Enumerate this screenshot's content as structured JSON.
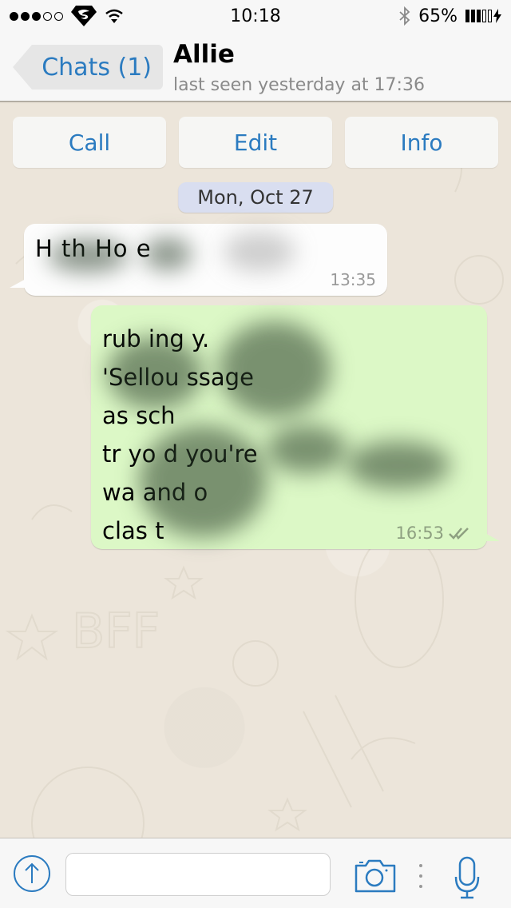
{
  "status_bar": {
    "signal_bars_filled": 3,
    "signal_bars_total": 5,
    "carrier_icon": "superman-logo-icon",
    "wifi_icon": "wifi-icon",
    "time": "10:18",
    "bluetooth_icon": "bluetooth-icon",
    "battery_percent": "65%",
    "battery_icon": "battery-charging-icon"
  },
  "header": {
    "back_label": "Chats (1)",
    "contact_name": "Allie",
    "last_seen": "last seen yesterday at 17:36"
  },
  "actions": {
    "call_label": "Call",
    "edit_label": "Edit",
    "info_label": "Info"
  },
  "chat": {
    "date_label": "Mon, Oct 27",
    "messages": [
      {
        "direction": "incoming",
        "text": "H        th        Ho        e",
        "time": "13:35"
      },
      {
        "direction": "outgoing",
        "lines": [
          "        rub        ing        y.",
          "'Sellou                    ssage",
          "as                sch",
          "tr        yo        d you're",
          "wa                and o",
          "clas           t"
        ],
        "time": "16:53",
        "status": "read",
        "status_icon": "double-check-icon"
      }
    ]
  },
  "input_bar": {
    "share_icon": "share-arrow-icon",
    "message_value": "",
    "message_placeholder": "",
    "camera_icon": "camera-icon",
    "mic_icon": "microphone-icon"
  },
  "colors": {
    "accent": "#2b7bc0",
    "outgoing_bubble": "#dcf8c6",
    "incoming_bubble": "#fdfdfd",
    "date_pill": "#d9def0",
    "chat_background": "#ece5da"
  }
}
